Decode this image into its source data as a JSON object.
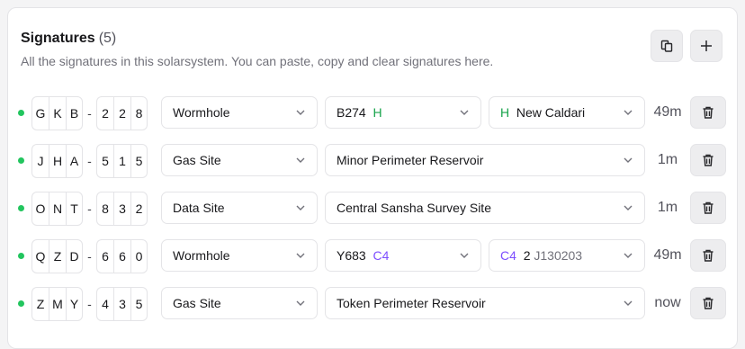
{
  "header": {
    "title": "Signatures",
    "count": "(5)",
    "subtitle": "All the signatures in this solarsystem. You can paste, copy and clear signatures here."
  },
  "toolbar": {
    "copy_icon": "copy-icon",
    "add_icon": "plus-icon"
  },
  "colors": {
    "status_dot": "#22c55e",
    "class_h": "#16a34a",
    "class_c4": "#7c4dff"
  },
  "rows": [
    {
      "sig_letters": [
        "G",
        "K",
        "B"
      ],
      "sig_digits": [
        "2",
        "2",
        "8"
      ],
      "type": "Wormhole",
      "wh_code": "B274",
      "wh_class": "H",
      "dest_class": "H",
      "dest_name": "New Caldari",
      "age": "49m"
    },
    {
      "sig_letters": [
        "J",
        "H",
        "A"
      ],
      "sig_digits": [
        "5",
        "1",
        "5"
      ],
      "type": "Gas Site",
      "site_name": "Minor Perimeter Reservoir",
      "age": "1m"
    },
    {
      "sig_letters": [
        "O",
        "N",
        "T"
      ],
      "sig_digits": [
        "8",
        "3",
        "2"
      ],
      "type": "Data Site",
      "site_name": "Central Sansha Survey Site",
      "age": "1m"
    },
    {
      "sig_letters": [
        "Q",
        "Z",
        "D"
      ],
      "sig_digits": [
        "6",
        "6",
        "0"
      ],
      "type": "Wormhole",
      "wh_code": "Y683",
      "wh_class": "C4",
      "dest_class": "C4",
      "dest_effect": "2",
      "dest_name": "J130203",
      "age": "49m"
    },
    {
      "sig_letters": [
        "Z",
        "M",
        "Y"
      ],
      "sig_digits": [
        "4",
        "3",
        "5"
      ],
      "type": "Gas Site",
      "site_name": "Token Perimeter Reservoir",
      "age": "now"
    }
  ]
}
